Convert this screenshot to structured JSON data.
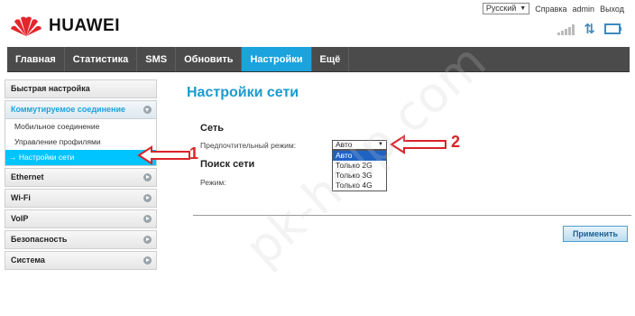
{
  "header": {
    "logo_text": "HUAWEI",
    "language": "Русский",
    "help": "Справка",
    "user": "admin",
    "logout": "Выход"
  },
  "nav": {
    "items": [
      {
        "label": "Главная"
      },
      {
        "label": "Статистика"
      },
      {
        "label": "SMS"
      },
      {
        "label": "Обновить"
      },
      {
        "label": "Настройки"
      },
      {
        "label": "Ещё"
      }
    ],
    "active_index": 4
  },
  "sidebar": {
    "quick_setup": "Быстрая настройка",
    "dialup": "Коммутируемое соединение",
    "sub_items": [
      {
        "label": "Мобильное соединение"
      },
      {
        "label": "Управление профилями"
      },
      {
        "label": "→ Настройки сети"
      }
    ],
    "items": [
      {
        "label": "Ethernet"
      },
      {
        "label": "Wi-Fi"
      },
      {
        "label": "VoIP"
      },
      {
        "label": "Безопасность"
      },
      {
        "label": "Система"
      }
    ]
  },
  "main": {
    "title": "Настройки сети",
    "network_section": "Сеть",
    "preferred_mode_label": "Предпочтительный режим:",
    "preferred_mode_value": "Авто",
    "mode_options": [
      "Авто",
      "Только 2G",
      "Только 3G",
      "Только 4G"
    ],
    "search_section": "Поиск сети",
    "mode_label": "Режим:",
    "apply_button": "Применить"
  },
  "annotations": {
    "label_1": "1",
    "label_2": "2"
  },
  "watermark": "pk-help.com",
  "colors": {
    "accent": "#1aa3dd",
    "nav_background": "#4b4b4b",
    "active_sub_item": "#00c4ff",
    "annotation_red": "#d9232a",
    "selected_option": "#1e63c4"
  }
}
